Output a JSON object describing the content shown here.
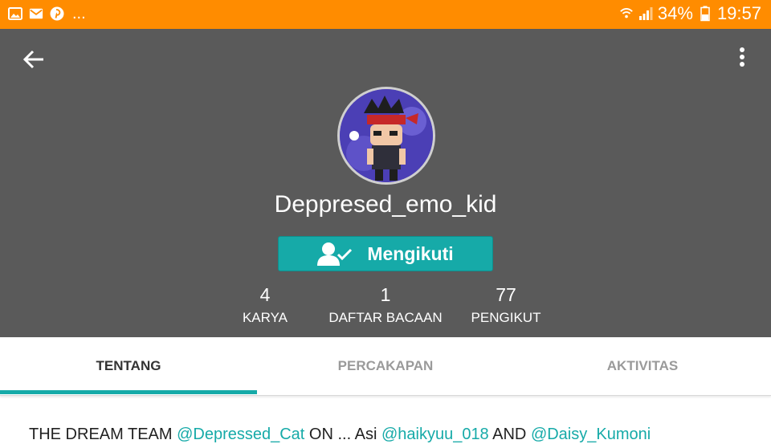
{
  "status_bar": {
    "left_icons": [
      "image-icon",
      "mail-icon",
      "pinterest-icon"
    ],
    "overflow": "...",
    "battery": "34%",
    "time": "19:57",
    "color": "#ff8c00"
  },
  "profile": {
    "username": "Deppresed_emo_kid",
    "follow_button_label": "Mengikuti",
    "stats": [
      {
        "value": "4",
        "label": "KARYA"
      },
      {
        "value": "1",
        "label": "DAFTAR BACAAN"
      },
      {
        "value": "77",
        "label": "PENGIKUT"
      }
    ]
  },
  "tabs": [
    {
      "label": "TENTANG",
      "active": true
    },
    {
      "label": "PERCAKAPAN",
      "active": false
    },
    {
      "label": "AKTIVITAS",
      "active": false
    }
  ],
  "about": {
    "text_1": "THE DREAM TEAM ",
    "mention_1": "@Depressed_Cat",
    "text_2": " ON ... Asi ",
    "mention_2": "@haikyuu_018",
    "text_3": " AND ",
    "mention_3": "@Daisy_Kumoni"
  },
  "colors": {
    "accent": "#16aaa8",
    "header_bg": "#5a5a5a"
  }
}
